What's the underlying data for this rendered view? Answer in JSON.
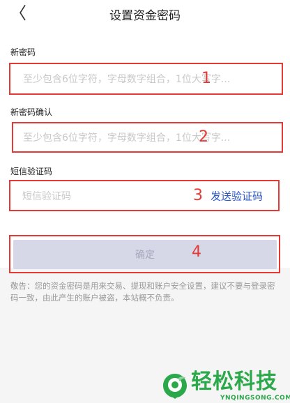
{
  "header": {
    "back_glyph": "〈",
    "title": "设置资金密码"
  },
  "form": {
    "new_password": {
      "label": "新密码",
      "placeholder": "至少包含6位字符，字母数字组合，1位大写字...",
      "annotation": "1"
    },
    "confirm_password": {
      "label": "新密码确认",
      "placeholder": "至少包含6位字符，字母数字组合，1位大写字...",
      "annotation": "2"
    },
    "sms_code": {
      "label": "短信验证码",
      "placeholder": "短信验证码",
      "annotation": "3",
      "send_label": "发送验证码"
    },
    "confirm": {
      "label": "确定",
      "annotation": "4"
    }
  },
  "warning_text": "敬告：您的资金密码是用来交易、提现和账户安全设置，建议不要与登录密码一致，由此产生的账户被盗，本站概不负责。",
  "watermark": {
    "name": "轻松科技",
    "url": "YNQINGSONG.COM"
  },
  "colors": {
    "annotation_red": "#e53935",
    "link_blue": "#2a56c6",
    "brand_green": "#2aa84a",
    "button_disabled": "#d6d8e8"
  }
}
